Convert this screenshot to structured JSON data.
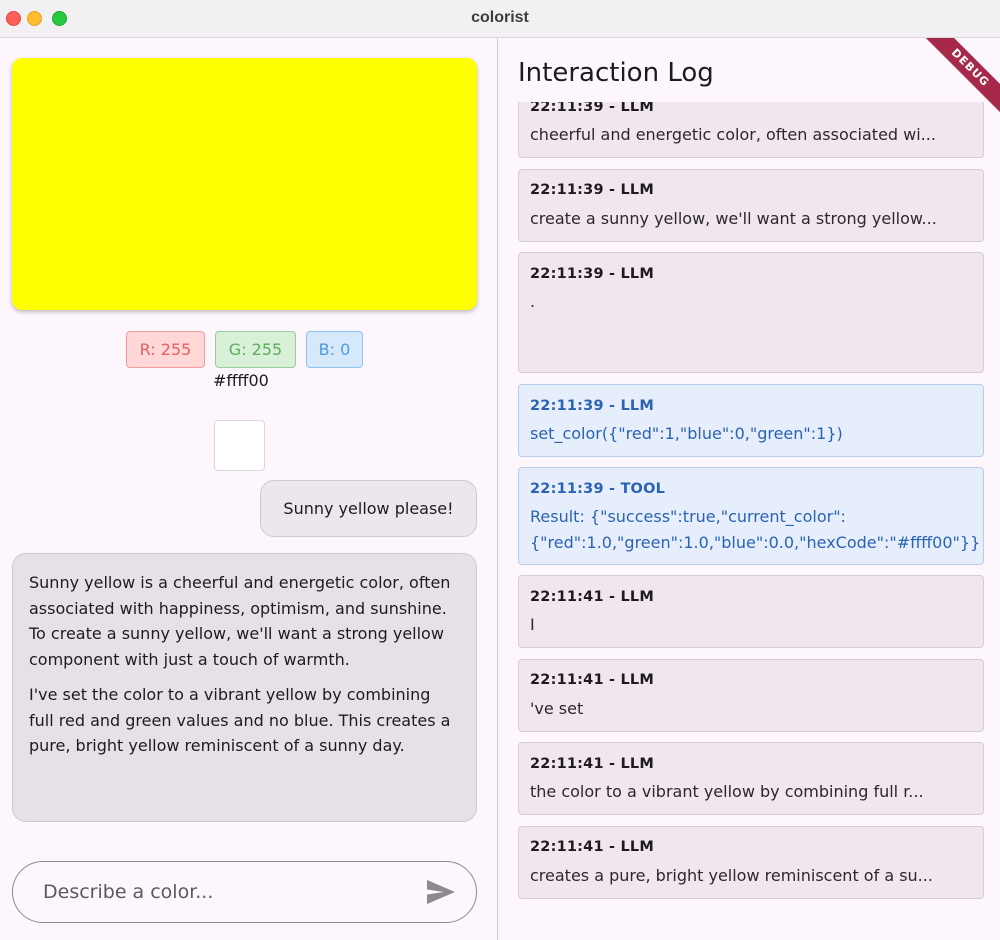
{
  "window": {
    "title": "colorist"
  },
  "color": {
    "hex_color": "#ffff00",
    "r_label": "R: 255",
    "g_label": "G: 255",
    "b_label": "B: 0",
    "hex_label": "#ffff00"
  },
  "chat": {
    "user_message": "Sunny yellow please!",
    "ai_paragraphs": [
      "Sunny yellow is a cheerful and energetic color, often associated with happiness, optimism, and sunshine. To create a sunny yellow, we'll want a strong yellow component with just a touch of warmth.",
      "I've set the color to a vibrant yellow by combining full red and green values and no blue. This creates a pure, bright yellow reminiscent of a sunny day."
    ],
    "input_placeholder": "Describe a color...",
    "input_value": ""
  },
  "log": {
    "title": "Interaction Log",
    "debug_banner": "DEBUG",
    "entries": [
      {
        "head": "22:11:39 - LLM",
        "body": " cheerful and energetic color, often associated wi...",
        "kind": "llm"
      },
      {
        "head": "22:11:39 - LLM",
        "body": " create a sunny yellow, we'll want a strong yellow...",
        "kind": "llm"
      },
      {
        "head": "22:11:39 - LLM",
        "body": ".",
        "kind": "llm"
      },
      {
        "head": "22:11:39 - LLM",
        "body": "set_color({\"red\":1,\"blue\":0,\"green\":1})",
        "kind": "blue"
      },
      {
        "head": "22:11:39 - TOOL",
        "body": "Result: {\"success\":true,\"current_color\": {\"red\":1.0,\"green\":1.0,\"blue\":0.0,\"hexCode\":\"#ffff00\"}}",
        "kind": "blue"
      },
      {
        "head": "22:11:41 - LLM",
        "body": "I",
        "kind": "llm"
      },
      {
        "head": "22:11:41 - LLM",
        "body": "'ve set",
        "kind": "llm"
      },
      {
        "head": "22:11:41 - LLM",
        "body": " the color to a vibrant yellow by combining full r...",
        "kind": "llm"
      },
      {
        "head": "22:11:41 - LLM",
        "body": " creates a pure, bright yellow reminiscent of a su...",
        "kind": "llm"
      }
    ]
  },
  "icons": {
    "send": "send-icon"
  }
}
